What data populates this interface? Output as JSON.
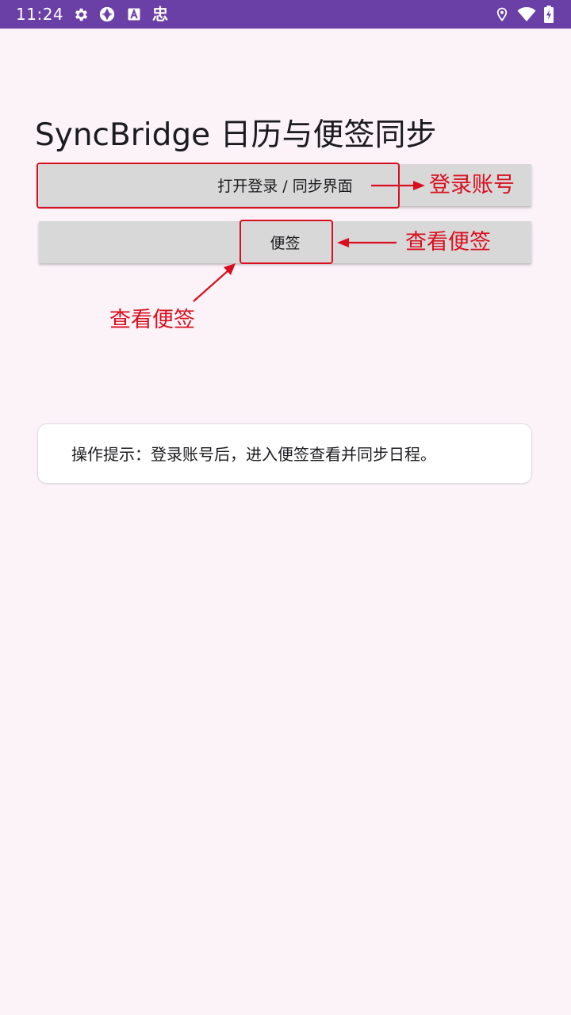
{
  "status_bar": {
    "time": "11:24",
    "left_icons": [
      "gear-icon",
      "aperture-icon",
      "app-a-icon"
    ],
    "left_glyph": "忠",
    "right_icons": [
      "location-icon",
      "wifi-icon",
      "battery-charging-icon"
    ],
    "background_color": "#6a3fa6"
  },
  "page": {
    "title": "SyncBridge 日历与便签同步"
  },
  "buttons": {
    "login_label": "打开登录 / 同步界面",
    "notes_label": "便签"
  },
  "annotations": {
    "login_callout": "登录账号",
    "notes_callout_right": "查看便签",
    "notes_callout_below": "查看便签",
    "color": "#d90f1f"
  },
  "hint": {
    "text": "操作提示：登录账号后，进入便签查看并同步日程。"
  }
}
